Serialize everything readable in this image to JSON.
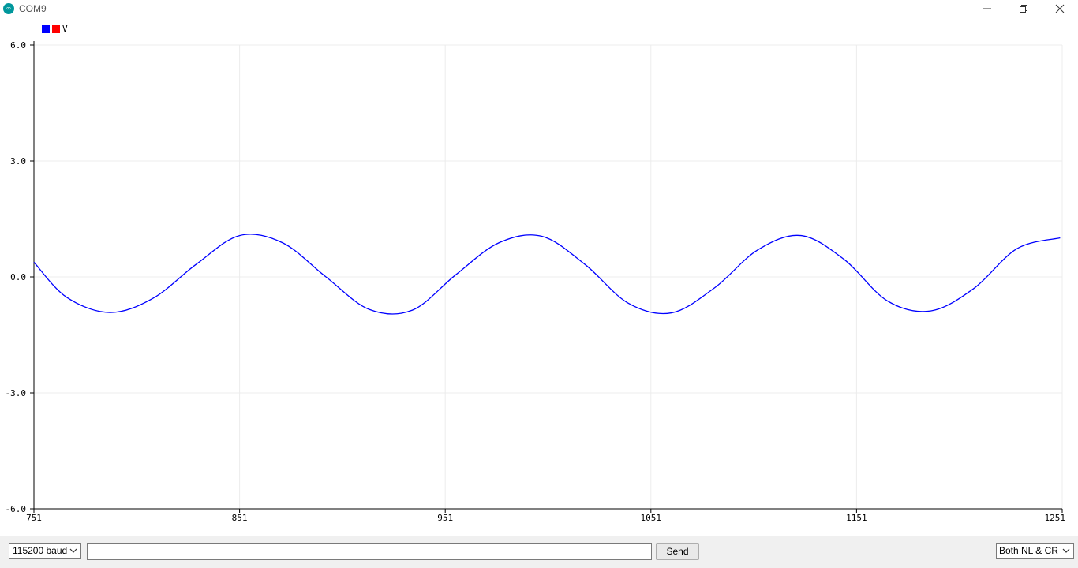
{
  "window": {
    "title": "COM9",
    "icon": "arduino-icon",
    "controls": {
      "minimize": "minimize-icon",
      "maximize": "restore-icon",
      "close": "close-icon"
    }
  },
  "chart_data": {
    "type": "line",
    "title": "",
    "xlabel": "",
    "ylabel": "",
    "xlim": [
      751,
      1251
    ],
    "ylim": [
      -6.0,
      6.0
    ],
    "x_ticks": [
      "751",
      "851",
      "951",
      "1051",
      "1151",
      "1251"
    ],
    "y_ticks": [
      "6.0",
      "3.0",
      "0.0",
      "-3.0",
      "-6.0"
    ],
    "grid": true,
    "legend": {
      "placement": "top-left",
      "label": "V",
      "swatch_colors": [
        "#0000ff",
        "#ff0000"
      ]
    },
    "series": [
      {
        "name": "V",
        "color": "#0000ff",
        "x": [
          751,
          767,
          788,
          809,
          830,
          851,
          872,
          893,
          914,
          935,
          956,
          977,
          998,
          1019,
          1040,
          1061,
          1082,
          1103,
          1124,
          1145,
          1166,
          1187,
          1208,
          1229,
          1250
        ],
        "values": [
          0.38,
          -0.53,
          -0.92,
          -0.55,
          0.33,
          1.07,
          0.88,
          0.0,
          -0.84,
          -0.86,
          0.05,
          0.88,
          1.05,
          0.32,
          -0.68,
          -0.93,
          -0.28,
          0.7,
          1.07,
          0.45,
          -0.62,
          -0.88,
          -0.3,
          0.73,
          1.01
        ]
      }
    ]
  },
  "controls": {
    "baud": "115200 baud",
    "send_input_value": "",
    "send_label": "Send",
    "line_ending": "Both NL & CR"
  }
}
